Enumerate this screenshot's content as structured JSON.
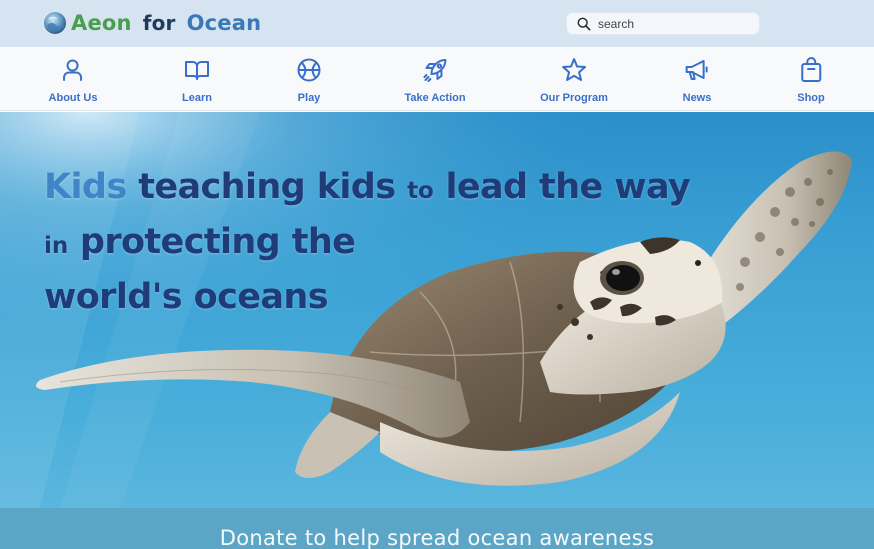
{
  "brand": {
    "word1": "Aeon",
    "word2": "for",
    "word3": "Ocean",
    "colors": {
      "aeon": "#4a9d4c",
      "for": "#1e3a5f",
      "ocean": "#3a78b8"
    }
  },
  "search": {
    "placeholder": "search",
    "icon": "search-icon"
  },
  "nav": {
    "accent": "#3a6fc8",
    "items": [
      {
        "label": "About Us",
        "icon": "person-icon"
      },
      {
        "label": "Learn",
        "icon": "book-icon"
      },
      {
        "label": "Play",
        "icon": "ball-icon"
      },
      {
        "label": "Take Action",
        "icon": "rocket-icon"
      },
      {
        "label": "Our Program",
        "icon": "star-icon"
      },
      {
        "label": "News",
        "icon": "megaphone-icon"
      },
      {
        "label": "Shop",
        "icon": "shopping-bag-icon"
      }
    ]
  },
  "hero": {
    "line1": {
      "a": "Kids",
      "b": "teaching kids",
      "c": "to",
      "d": "lead the way"
    },
    "line2": {
      "a": "in",
      "b": "protecting the"
    },
    "line3": "world's oceans",
    "image": "sea-turtle-swimming"
  },
  "donate": {
    "text": "Donate to help spread ocean awareness"
  }
}
